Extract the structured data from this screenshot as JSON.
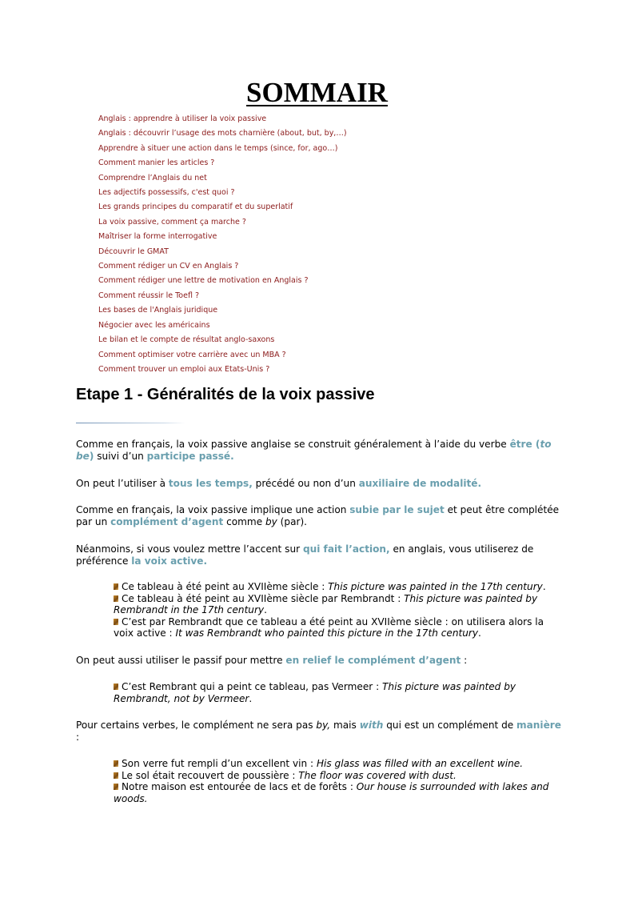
{
  "title": "SOMMAIR",
  "toc": [
    "Anglais : apprendre à utiliser la voix passive",
    "Anglais : découvrir l’usage des mots charnière (about, but, by,…)",
    "Apprendre à situer une action dans le temps (since, for, ago…)",
    "Comment manier les articles ?",
    "Comprendre l’Anglais du net",
    "Les adjectifs possessifs, c'est quoi ?",
    "Les grands principes du comparatif et du superlatif",
    "La voix passive, comment ça marche ?",
    "Maîtriser la forme interrogative",
    "Découvrir le GMAT",
    "Comment rédiger un CV en Anglais ?",
    "Comment rédiger une lettre de motivation en Anglais ?",
    "Comment réussir le Toefl ?",
    "Les bases de l'Anglais juridique",
    "Négocier avec les américains",
    "Le bilan et le compte de résultat anglo-saxons",
    "Comment optimiser votre carrière avec un MBA ?",
    "Comment trouver un emploi aux Etats-Unis ?"
  ],
  "heading": "Etape 1 - Généralités de la voix passive",
  "p1": {
    "t1": "Comme en français, la voix passive anglaise se construit généralement à l’aide du verbe ",
    "h1": "être (",
    "h1i": "to be",
    "h1b": ")",
    "t2": " suivi d’un ",
    "h2": "participe passé."
  },
  "p2": {
    "t1": "On peut l’utiliser à ",
    "h1": "tous les temps,",
    "t2": " précédé ou non d’un ",
    "h2": "auxiliaire de modalité."
  },
  "p3": {
    "t1": "Comme en français, la voix passive implique une action ",
    "h1": "subie par le sujet",
    "t2": " et peut être complétée par un ",
    "h2": "complément d’agent",
    "t3": " comme ",
    "i1": "by",
    "t4": " (par)."
  },
  "p4": {
    "t1": "Néanmoins, si vous voulez mettre l’accent sur ",
    "h1": "qui fait l’action,",
    "t2": " en anglais, vous utiliserez de préférence ",
    "h2": "la voix active."
  },
  "list1": [
    {
      "fr": "Ce tableau à été peint au XVIIème siècle : ",
      "en": "This picture was painted in the 17th century",
      "end": "."
    },
    {
      "fr": "Ce tableau à été peint au XVIIème siècle par Rembrandt : ",
      "en": "This picture was painted by Rembrandt in the 17th century",
      "end": "."
    },
    {
      "fr": "C’est par Rembrandt que ce tableau a été peint au XVIIème siècle : on utilisera alors la voix active : ",
      "en": "It was Rembrandt who painted this picture in the 17th century",
      "end": "."
    }
  ],
  "p5": {
    "t1": "On peut aussi utiliser le passif pour mettre ",
    "h1": "en relief le complément d’agent",
    "t2": "  :"
  },
  "list2": [
    {
      "fr": "C’est Rembrant qui a peint ce tableau, pas Vermeer : ",
      "en": "This picture was painted by Rembrandt, not by Vermeer",
      "end": "."
    }
  ],
  "p6": {
    "t1": "Pour certains verbes, le complément ne sera pas ",
    "i1": "by,",
    "t2": " mais ",
    "h1": "with",
    "t3": "  qui est un complément de ",
    "h2": "manière",
    "t4": " :"
  },
  "list3": [
    {
      "fr": "Son verre fut rempli d’un excellent vin : ",
      "en": "His glass was filled with an excellent wine.",
      "end": ""
    },
    {
      "fr": "Le sol était recouvert de poussière : ",
      "en": "The floor was covered with dust.",
      "end": ""
    },
    {
      "fr": "Notre maison est entourée de lacs et de forêts : ",
      "en": "Our house is surrounded with lakes and woods.",
      "end": ""
    }
  ],
  "colors": {
    "toc_link": "#8b1a1a",
    "highlight": "#6a9fae"
  }
}
